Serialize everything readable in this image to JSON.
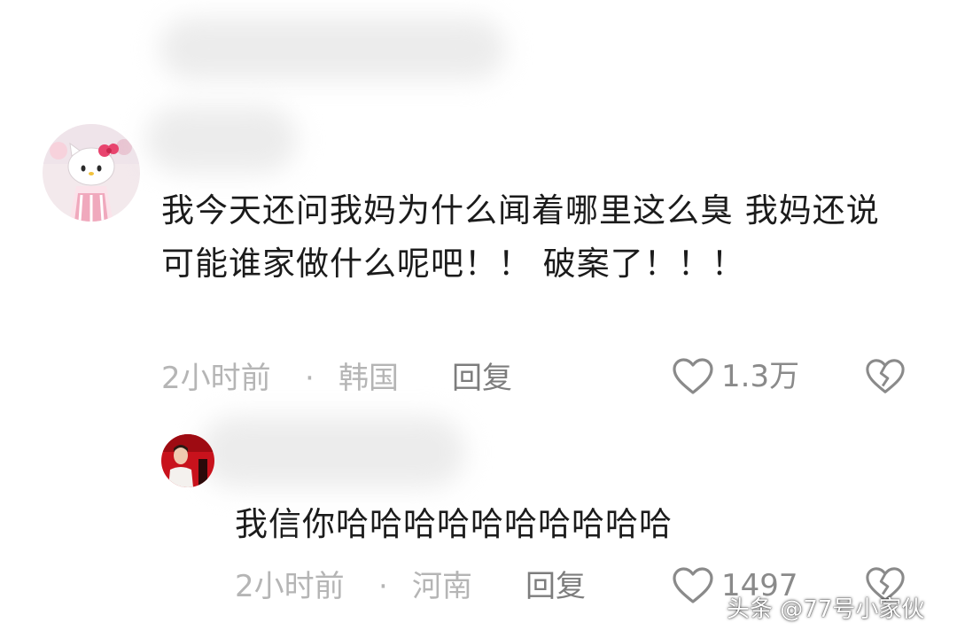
{
  "comments": [
    {
      "text": "我今天还问我妈为什么闻着哪里这么臭 我妈还说可能谁家做什么呢吧！！ 破案了！！！",
      "time": "2小时前",
      "separator": "·",
      "location": "韩国",
      "reply_label": "回复",
      "likes": "1.3万"
    },
    {
      "text": "我信你哈哈哈哈哈哈哈哈哈哈",
      "time": "2小时前",
      "separator": "·",
      "location": "河南",
      "reply_label": "回复",
      "likes": "1497"
    }
  ],
  "watermark": "头条 @77号小家伙",
  "colors": {
    "text": "#1b1b1b",
    "meta": "#b5b5b5",
    "reply": "#7d7d7d",
    "icon": "#8a8a8a"
  }
}
